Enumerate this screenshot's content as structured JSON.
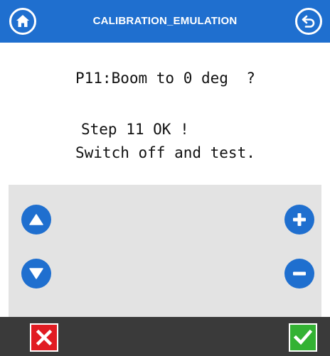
{
  "header": {
    "title": "CALIBRATION_EMULATION",
    "home_icon": "home-icon",
    "back_icon": "back-arrow-icon"
  },
  "message": {
    "line1": "P11:Boom to 0 deg  ?",
    "line2": "Step 11 OK !",
    "line3": "Switch off and test."
  },
  "controls": {
    "up_icon": "arrow-up-icon",
    "down_icon": "arrow-down-icon",
    "plus_icon": "plus-icon",
    "minus_icon": "minus-icon"
  },
  "footer": {
    "cancel_icon": "close-icon",
    "ok_icon": "check-icon"
  },
  "colors": {
    "accent": "#1f6fcf",
    "panel": "#e3e3e3",
    "footer": "#3a3a3a",
    "cancel": "#e11b22",
    "confirm": "#33b233"
  }
}
